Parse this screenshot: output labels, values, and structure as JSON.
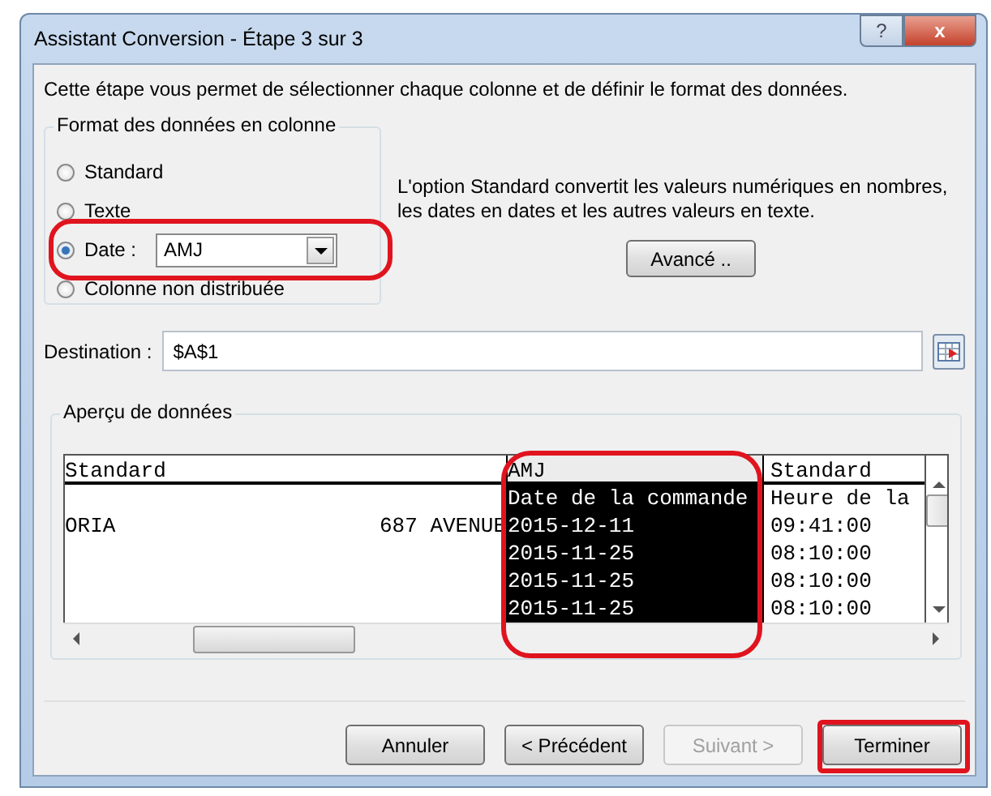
{
  "window": {
    "title": "Assistant Conversion - Étape 3 sur 3",
    "buttons": [
      {
        "kind": "help",
        "label": "?"
      },
      {
        "kind": "close",
        "label": "x"
      }
    ]
  },
  "intro": "Cette étape vous permet de sélectionner chaque colonne et de définir le format des données.",
  "format_group": {
    "title": "Format des données en colonne",
    "options": [
      {
        "label": "Standard",
        "selected": false
      },
      {
        "label": "Texte",
        "selected": false
      },
      {
        "label": "Date :",
        "selected": true,
        "dropdown": "AMJ"
      },
      {
        "label": "Colonne non distribuée",
        "selected": false
      }
    ]
  },
  "explanation": "L'option Standard convertit les valeurs numériques en nombres, les dates en dates et les autres valeurs en texte.",
  "advanced_button": "Avancé ..",
  "destination": {
    "label": "Destination :",
    "value": "$A$1"
  },
  "preview": {
    "title": "Aperçu de données",
    "columns": [
      {
        "header": "Standard",
        "selected": false
      },
      {
        "header": "AMJ",
        "selected": true
      },
      {
        "header": "Standard",
        "selected": false
      }
    ],
    "rows": [
      {
        "cells": [
          null,
          "Date de la commande",
          "Heure de la"
        ]
      },
      {
        "cells": [
          [
            "ORIA",
            "687 AVENUE"
          ],
          "2015-12-11",
          "09:41:00"
        ]
      },
      {
        "cells": [
          null,
          "2015-11-25",
          "08:10:00"
        ]
      },
      {
        "cells": [
          null,
          "2015-11-25",
          "08:10:00"
        ]
      },
      {
        "cells": [
          null,
          "2015-11-25",
          "08:10:00"
        ]
      }
    ]
  },
  "buttons": [
    {
      "label": "Annuler",
      "disabled": false
    },
    {
      "label": "< Précédent",
      "disabled": false
    },
    {
      "label": "Suivant >",
      "disabled": true
    },
    {
      "label": "Terminer",
      "disabled": false
    }
  ]
}
